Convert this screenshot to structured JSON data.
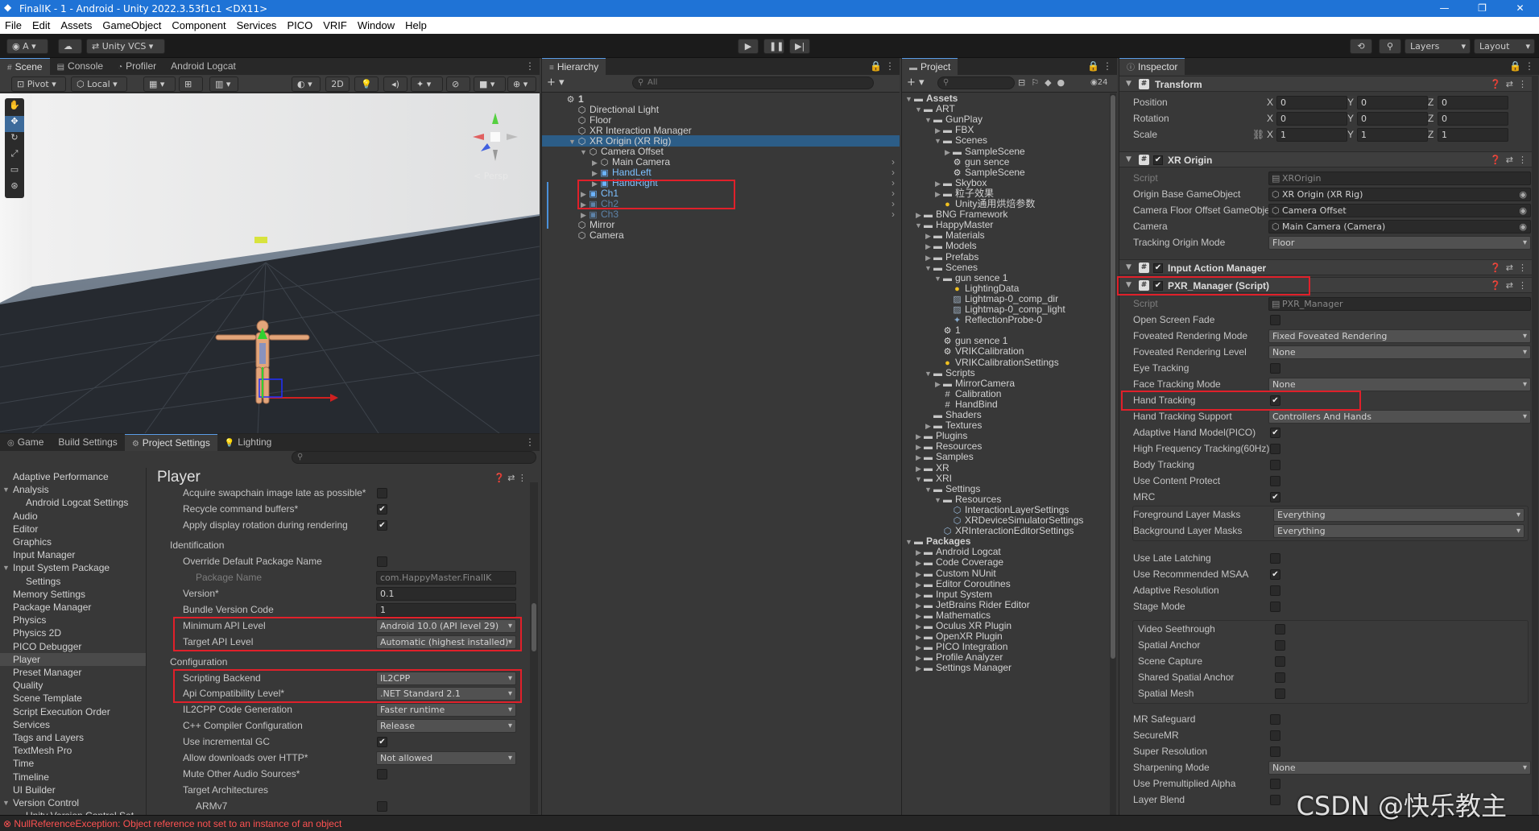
{
  "titlebar": {
    "title": "FinalIK - 1 - Android - Unity 2022.3.53f1c1 <DX11>",
    "minimize": "—",
    "maximize": "❐",
    "close": "✕"
  },
  "menu": [
    "File",
    "Edit",
    "Assets",
    "GameObject",
    "Component",
    "Services",
    "PICO",
    "VRIF",
    "Window",
    "Help"
  ],
  "toolbar": {
    "account": "A",
    "cloud": "☁",
    "vcs": "Unity VCS",
    "layers": "Layers",
    "layout": "Layout"
  },
  "scene": {
    "tabs": [
      "Scene",
      "Console",
      "Profiler",
      "Android Logcat"
    ],
    "pivot": "Pivot",
    "local": "Local",
    "mode2d": "2D",
    "persp": "< Persp"
  },
  "bottom_tabs": [
    "Game",
    "Build Settings",
    "Project Settings",
    "Lighting"
  ],
  "settings_nav": [
    "Adaptive Performance",
    "Analysis",
    "Android Logcat Settings",
    "Audio",
    "Editor",
    "Graphics",
    "Input Manager",
    "Input System Package",
    "Settings",
    "Memory Settings",
    "Package Manager",
    "Physics",
    "Physics 2D",
    "PICO Debugger",
    "Player",
    "Preset Manager",
    "Quality",
    "Scene Template",
    "Script Execution Order",
    "Services",
    "Tags and Layers",
    "TextMesh Pro",
    "Time",
    "Timeline",
    "UI Builder",
    "Version Control",
    "Unity Version Control Set"
  ],
  "player": {
    "title": "Player",
    "top_rows": [
      {
        "label": "Acquire swapchain image late as possible*",
        "checked": false
      },
      {
        "label": "Recycle command buffers*",
        "checked": true
      },
      {
        "label": "Apply display rotation during rendering",
        "checked": true
      }
    ],
    "identification": "Identification",
    "override_label": "Override Default Package Name",
    "package_name_label": "Package Name",
    "package_name": "com.HappyMaster.FinalIK",
    "version_label": "Version*",
    "version": "0.1",
    "bundle_label": "Bundle Version Code",
    "bundle": "1",
    "min_api_label": "Minimum API Level",
    "min_api": "Android 10.0 (API level 29)",
    "target_api_label": "Target API Level",
    "target_api": "Automatic (highest installed)",
    "configuration": "Configuration",
    "backend_label": "Scripting Backend",
    "backend": "IL2CPP",
    "compat_label": "Api Compatibility Level*",
    "compat": ".NET Standard 2.1",
    "codegen_label": "IL2CPP Code Generation",
    "codegen": "Faster runtime",
    "cpp_label": "C++ Compiler Configuration",
    "cpp": "Release",
    "gc_label": "Use incremental GC",
    "http_label": "Allow downloads over HTTP*",
    "http": "Not allowed",
    "mute_label": "Mute Other Audio Sources*",
    "arch_label": "Target Architectures",
    "arm": "ARMv7"
  },
  "hierarchy": {
    "tab": "Hierarchy",
    "search": "All",
    "items": [
      {
        "label": "1",
        "depth": 0,
        "icon": "unity-scene-icon",
        "bold": true
      },
      {
        "label": "Directional Light",
        "depth": 1,
        "icon": "cube-icon"
      },
      {
        "label": "Floor",
        "depth": 1,
        "icon": "cube-icon"
      },
      {
        "label": "XR Interaction Manager",
        "depth": 1,
        "icon": "cube-icon"
      },
      {
        "label": "XR Origin (XR Rig)",
        "depth": 1,
        "icon": "cube-icon",
        "open": true,
        "selected": true
      },
      {
        "label": "Camera Offset",
        "depth": 2,
        "icon": "cube-icon",
        "open": true
      },
      {
        "label": "Main Camera",
        "depth": 3,
        "icon": "cube-icon",
        "closed": true
      },
      {
        "label": "HandLeft",
        "depth": 3,
        "icon": "prefab-icon",
        "closed": true,
        "prefab": true
      },
      {
        "label": "HandRight",
        "depth": 3,
        "icon": "prefab-icon",
        "closed": true,
        "prefab": true
      },
      {
        "label": "Ch1",
        "depth": 2,
        "icon": "prefab-icon",
        "closed": true,
        "prefab": true
      },
      {
        "label": "Ch2",
        "depth": 2,
        "icon": "prefab-icon",
        "closed": true,
        "faded": true
      },
      {
        "label": "Ch3",
        "depth": 2,
        "icon": "prefab-icon",
        "closed": true,
        "faded": true
      },
      {
        "label": "Mirror",
        "depth": 1,
        "icon": "cube-icon"
      },
      {
        "label": "Camera",
        "depth": 1,
        "icon": "cube-icon"
      }
    ]
  },
  "project": {
    "tab": "Project",
    "count": "24",
    "items": [
      {
        "label": "Assets",
        "depth": 0,
        "t": "o",
        "bold": true
      },
      {
        "label": "ART",
        "depth": 1,
        "t": "o"
      },
      {
        "label": "GunPlay",
        "depth": 2,
        "t": "o"
      },
      {
        "label": "FBX",
        "depth": 3,
        "t": "c"
      },
      {
        "label": "Scenes",
        "depth": 3,
        "t": "o"
      },
      {
        "label": "SampleScene",
        "depth": 4,
        "t": "c"
      },
      {
        "label": "gun sence",
        "depth": 4,
        "t": "n",
        "icon": "unity"
      },
      {
        "label": "SampleScene",
        "depth": 4,
        "t": "n",
        "icon": "unity"
      },
      {
        "label": "Skybox",
        "depth": 3,
        "t": "c"
      },
      {
        "label": "粒子效果",
        "depth": 3,
        "t": "c"
      },
      {
        "label": "Unity通用烘焙参数",
        "depth": 3,
        "t": "n",
        "icon": "bulb"
      },
      {
        "label": "BNG Framework",
        "depth": 1,
        "t": "c"
      },
      {
        "label": "HappyMaster",
        "depth": 1,
        "t": "o"
      },
      {
        "label": "Materials",
        "depth": 2,
        "t": "c"
      },
      {
        "label": "Models",
        "depth": 2,
        "t": "c"
      },
      {
        "label": "Prefabs",
        "depth": 2,
        "t": "c"
      },
      {
        "label": "Scenes",
        "depth": 2,
        "t": "o"
      },
      {
        "label": "gun sence 1",
        "depth": 3,
        "t": "o"
      },
      {
        "label": "LightingData",
        "depth": 4,
        "t": "n",
        "icon": "bulb"
      },
      {
        "label": "Lightmap-0_comp_dir",
        "depth": 4,
        "t": "n",
        "icon": "img"
      },
      {
        "label": "Lightmap-0_comp_light",
        "depth": 4,
        "t": "n",
        "icon": "img"
      },
      {
        "label": "ReflectionProbe-0",
        "depth": 4,
        "t": "n",
        "icon": "probe"
      },
      {
        "label": "1",
        "depth": 3,
        "t": "n",
        "icon": "unity"
      },
      {
        "label": "gun sence 1",
        "depth": 3,
        "t": "n",
        "icon": "unity"
      },
      {
        "label": "VRIKCalibration",
        "depth": 3,
        "t": "n",
        "icon": "unity"
      },
      {
        "label": "VRIKCalibrationSettings",
        "depth": 3,
        "t": "n",
        "icon": "bulb"
      },
      {
        "label": "Scripts",
        "depth": 2,
        "t": "o"
      },
      {
        "label": "MirrorCamera",
        "depth": 3,
        "t": "c"
      },
      {
        "label": "Calibration",
        "depth": 3,
        "t": "n",
        "icon": "cs"
      },
      {
        "label": "HandBind",
        "depth": 3,
        "t": "n",
        "icon": "cs"
      },
      {
        "label": "Shaders",
        "depth": 2,
        "t": "e"
      },
      {
        "label": "Textures",
        "depth": 2,
        "t": "c"
      },
      {
        "label": "Plugins",
        "depth": 1,
        "t": "c"
      },
      {
        "label": "Resources",
        "depth": 1,
        "t": "c"
      },
      {
        "label": "Samples",
        "depth": 1,
        "t": "c"
      },
      {
        "label": "XR",
        "depth": 1,
        "t": "c"
      },
      {
        "label": "XRI",
        "depth": 1,
        "t": "o"
      },
      {
        "label": "Settings",
        "depth": 2,
        "t": "o"
      },
      {
        "label": "Resources",
        "depth": 3,
        "t": "o"
      },
      {
        "label": "InteractionLayerSettings",
        "depth": 4,
        "t": "n",
        "icon": "asset"
      },
      {
        "label": "XRDeviceSimulatorSettings",
        "depth": 4,
        "t": "n",
        "icon": "asset"
      },
      {
        "label": "XRInteractionEditorSettings",
        "depth": 3,
        "t": "n",
        "icon": "asset"
      },
      {
        "label": "Packages",
        "depth": 0,
        "t": "o",
        "bold": true
      },
      {
        "label": "Android Logcat",
        "depth": 1,
        "t": "c"
      },
      {
        "label": "Code Coverage",
        "depth": 1,
        "t": "c"
      },
      {
        "label": "Custom NUnit",
        "depth": 1,
        "t": "c"
      },
      {
        "label": "Editor Coroutines",
        "depth": 1,
        "t": "c"
      },
      {
        "label": "Input System",
        "depth": 1,
        "t": "c"
      },
      {
        "label": "JetBrains Rider Editor",
        "depth": 1,
        "t": "c"
      },
      {
        "label": "Mathematics",
        "depth": 1,
        "t": "c"
      },
      {
        "label": "Oculus XR Plugin",
        "depth": 1,
        "t": "c"
      },
      {
        "label": "OpenXR Plugin",
        "depth": 1,
        "t": "c"
      },
      {
        "label": "PICO Integration",
        "depth": 1,
        "t": "c"
      },
      {
        "label": "Profile Analyzer",
        "depth": 1,
        "t": "c"
      },
      {
        "label": "Settings Manager",
        "depth": 1,
        "t": "c"
      }
    ]
  },
  "inspector": {
    "tab": "Inspector",
    "transform": {
      "title": "Transform",
      "rows": [
        {
          "label": "Position",
          "x": "0",
          "y": "0",
          "z": "0"
        },
        {
          "label": "Rotation",
          "x": "0",
          "y": "0",
          "z": "0"
        },
        {
          "label": "Scale",
          "x": "1",
          "y": "1",
          "z": "1"
        }
      ]
    },
    "xr_origin": {
      "title": "XR Origin",
      "script_label": "Script",
      "script": "XROrigin",
      "rows": [
        {
          "label": "Origin Base GameObject",
          "value": "XR Origin (XR Rig)"
        },
        {
          "label": "Camera Floor Offset GameObject",
          "value": "Camera Offset"
        },
        {
          "label": "Camera",
          "value": "Main Camera (Camera)"
        },
        {
          "label": "Tracking Origin Mode",
          "value": "Floor"
        }
      ]
    },
    "input_action": "Input Action Manager",
    "pxr": {
      "title": "PXR_Manager (Script)",
      "script_label": "Script",
      "script": "PXR_Manager"
    },
    "pxr_rows": [
      {
        "label": "Open Screen Fade",
        "kind": "check",
        "checked": false
      },
      {
        "label": "Foveated Rendering Mode",
        "kind": "dd",
        "value": "Fixed Foveated Rendering"
      },
      {
        "label": "Foveated Rendering Level",
        "kind": "dd",
        "value": "None"
      },
      {
        "label": "Eye Tracking",
        "kind": "check",
        "checked": false
      },
      {
        "label": "Face Tracking Mode",
        "kind": "dd",
        "value": "None"
      },
      {
        "label": "Hand Tracking",
        "kind": "check",
        "checked": true
      },
      {
        "label": "Hand Tracking Support",
        "kind": "dd",
        "value": "Controllers And Hands"
      },
      {
        "label": "Adaptive Hand Model(PICO)",
        "kind": "check",
        "checked": true
      },
      {
        "label": "High Frequency Tracking(60Hz)",
        "kind": "check",
        "checked": false
      },
      {
        "label": "Body Tracking",
        "kind": "check",
        "checked": false
      },
      {
        "label": "Use Content Protect",
        "kind": "check",
        "checked": false
      },
      {
        "label": "MRC",
        "kind": "check",
        "checked": true
      }
    ],
    "masks": [
      {
        "label": "Foreground Layer Masks",
        "value": "Everything"
      },
      {
        "label": "Background Layer Masks",
        "value": "Everything"
      }
    ],
    "misc": [
      {
        "label": "Use Late Latching",
        "checked": false
      },
      {
        "label": "Use Recommended MSAA",
        "checked": true
      },
      {
        "label": "Adaptive Resolution",
        "checked": false
      },
      {
        "label": "Stage Mode",
        "checked": false
      }
    ],
    "mr": [
      "Video Seethrough",
      "Spatial Anchor",
      "Scene Capture",
      "Shared Spatial Anchor",
      "Spatial Mesh"
    ],
    "tail": [
      {
        "label": "MR Safeguard",
        "kind": "check"
      },
      {
        "label": "SecureMR",
        "kind": "check"
      },
      {
        "label": "Super Resolution",
        "kind": "check"
      },
      {
        "label": "Sharpening Mode",
        "kind": "dd",
        "value": "None"
      },
      {
        "label": "Use Premultiplied Alpha",
        "kind": "check"
      },
      {
        "label": "Layer Blend",
        "kind": "check"
      }
    ]
  },
  "status": {
    "error": "NullReferenceException: Object reference not set to an instance of an object"
  },
  "watermark": "CSDN @快乐教主"
}
